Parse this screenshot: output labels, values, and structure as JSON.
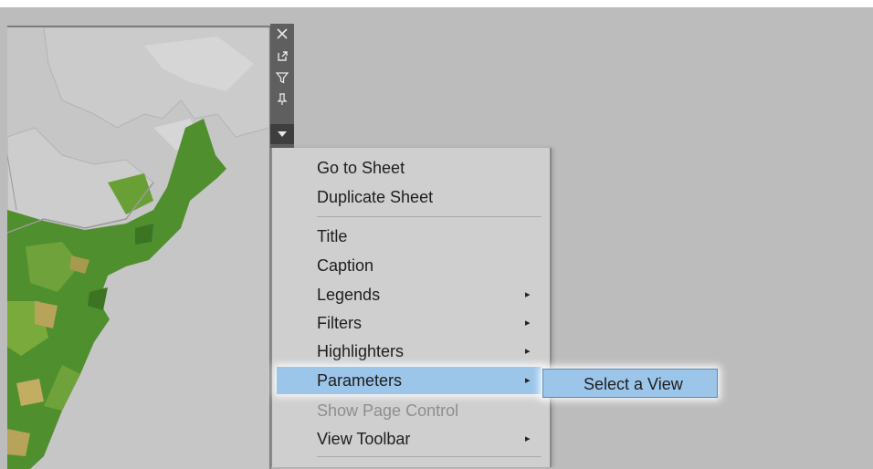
{
  "colors": {
    "background": "#bcbcbc",
    "map_land": "#c6c6c6",
    "map_water": "#d4d4d4",
    "map_green": "#4f8f2e",
    "map_light_green": "#7aaa3c",
    "map_tan": "#b8a35a",
    "toolbar": "#5f5f5f",
    "menu": "#cfcfcf",
    "highlight": "#9cc5ea"
  },
  "toolbar": {
    "icons": [
      "close-icon",
      "popout-icon",
      "filter-icon",
      "pin-icon",
      "dropdown-icon"
    ]
  },
  "menu": {
    "items": [
      {
        "label": "Go to Sheet",
        "submenu": false
      },
      {
        "label": "Duplicate Sheet",
        "submenu": false
      },
      {
        "label": "Title",
        "submenu": false
      },
      {
        "label": "Caption",
        "submenu": false
      },
      {
        "label": "Legends",
        "submenu": true
      },
      {
        "label": "Filters",
        "submenu": true
      },
      {
        "label": "Highlighters",
        "submenu": true
      },
      {
        "label": "Parameters",
        "submenu": true,
        "highlighted": true
      },
      {
        "label": "Show Page Control",
        "submenu": false,
        "disabled": true
      },
      {
        "label": "View Toolbar",
        "submenu": true
      }
    ],
    "submenu_arrow": "▸"
  },
  "submenu": {
    "items": [
      "Select a View"
    ]
  }
}
